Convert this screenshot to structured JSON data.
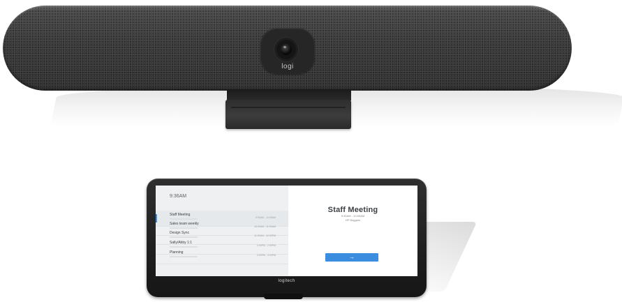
{
  "camera": {
    "brand_label": "logi"
  },
  "tablet": {
    "brand_label": "logitech",
    "screen": {
      "time": "9:36AM",
      "meetings": [
        {
          "name": "Staff Meeting",
          "range": "9:30AM - 10:00AM",
          "active": true
        },
        {
          "name": "Sales team weekly",
          "range": "10:00AM - 11:00AM",
          "active": false
        },
        {
          "name": "Design Sync",
          "range": "11:00AM - 12:00PM",
          "active": false
        },
        {
          "name": "Sally/Abby 1:1",
          "range": "1:00PM - 2:00PM",
          "active": false
        },
        {
          "name": "Planning",
          "range": "2:00PM - 3:00PM",
          "active": false
        }
      ],
      "selected": {
        "title": "Staff Meeting",
        "time": "9:30AM - 10:00AM",
        "room": "HP Boggers"
      },
      "join_button_icon": "arrow-right-icon",
      "join_arrow": "→"
    },
    "accent_color": "#3b8de0"
  }
}
